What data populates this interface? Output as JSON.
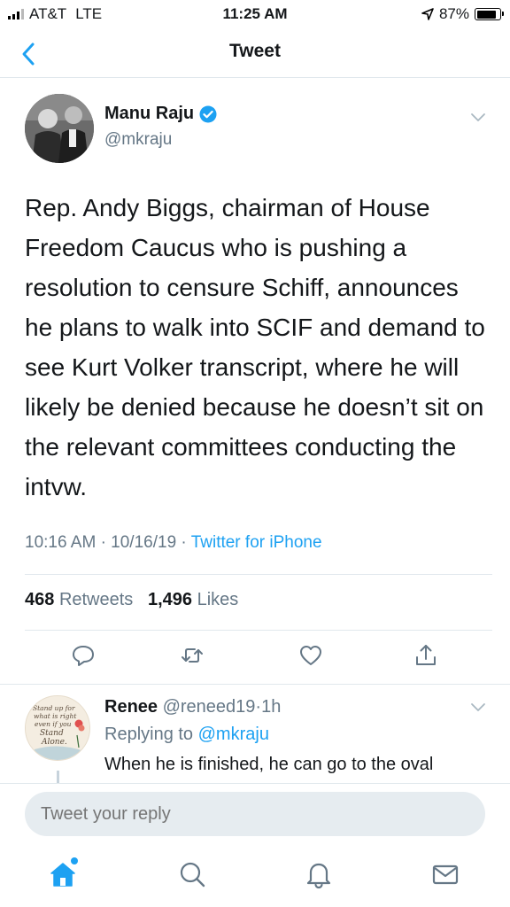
{
  "status_bar": {
    "carrier": "AT&T",
    "network": "LTE",
    "time": "11:25 AM",
    "battery": "87%",
    "battery_level": 0.87
  },
  "header": {
    "title": "Tweet",
    "back_icon": "chevron-left-icon"
  },
  "tweet": {
    "author_name": "Manu Raju",
    "author_handle": "@mkraju",
    "text": "Rep. Andy Biggs, chairman of House Freedom Caucus who is pushing a resolution to censure Schiff, announces he plans to walk into SCIF and demand to see Kurt Volker transcript, where he will likely be denied because he doesn’t sit on the relevant committees conducting the intvw.",
    "time": "10:16 AM",
    "date": "10/16/19",
    "source": "Twitter for iPhone",
    "separator": "·",
    "retweets_count": "468",
    "retweets_label": "Retweets",
    "likes_count": "1,496",
    "likes_label": "Likes"
  },
  "reply": {
    "author_name": "Renee",
    "author_handle": "@reneed19",
    "age": "1h",
    "replying_label": "Replying to",
    "replying_to": "@mkraju",
    "text": "When he is finished, he can go to the oval",
    "avatar_text": [
      "Stand up for",
      "what is right",
      "even if you",
      "Stand",
      "Alone."
    ]
  },
  "composer": {
    "placeholder": "Tweet your reply"
  },
  "colors": {
    "accent": "#1da1f2",
    "secondary_text": "#657786",
    "divider": "#e1e8ed"
  }
}
